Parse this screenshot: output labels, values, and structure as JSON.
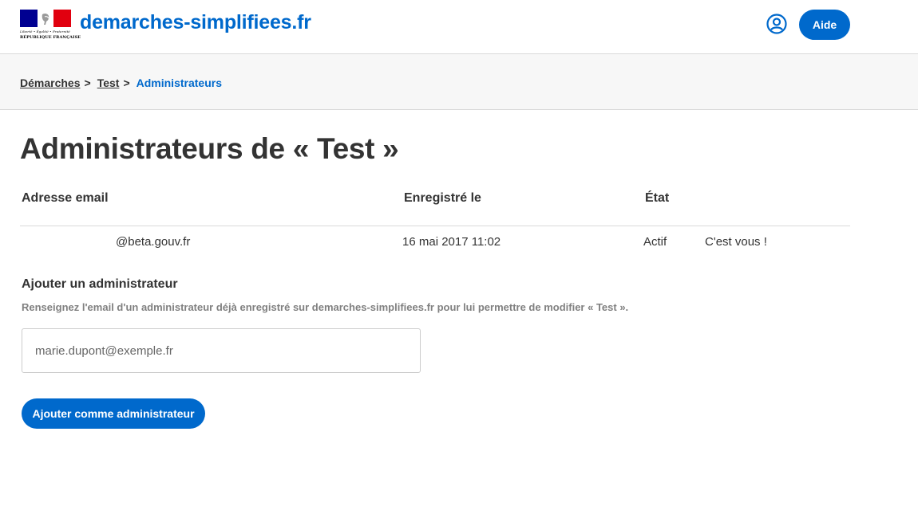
{
  "header": {
    "logo": {
      "motto": "Liberté • Égalité • Fraternité",
      "republique": "RÉPUBLIQUE FRANÇAISE"
    },
    "site_title": "demarches-simplifiees.fr",
    "user_icon": "user-circle-icon",
    "help_label": "Aide"
  },
  "breadcrumb": {
    "items": [
      "Démarches",
      "Test"
    ],
    "separator": ">",
    "current": "Administrateurs"
  },
  "page": {
    "title": "Administrateurs de « Test »"
  },
  "table": {
    "headers": [
      "Adresse email",
      "Enregistré le",
      "État"
    ],
    "rows": [
      {
        "email": "@beta.gouv.fr",
        "date": "16 mai 2017 11:02",
        "state": "Actif",
        "note": "C'est vous !"
      }
    ]
  },
  "add_admin": {
    "title": "Ajouter un administrateur",
    "help": "Renseignez l'email d'un administrateur déjà enregistré sur demarches-simplifiees.fr pour lui permettre de modifier « Test ».",
    "input_placeholder": "marie.dupont@exemple.fr",
    "input_value": "",
    "submit_label": "Ajouter comme administrateur"
  },
  "colors": {
    "brand_blue": "#0069cc",
    "text": "#333333",
    "muted": "#808080",
    "flag_blue": "#000091",
    "flag_red": "#e1000f"
  }
}
